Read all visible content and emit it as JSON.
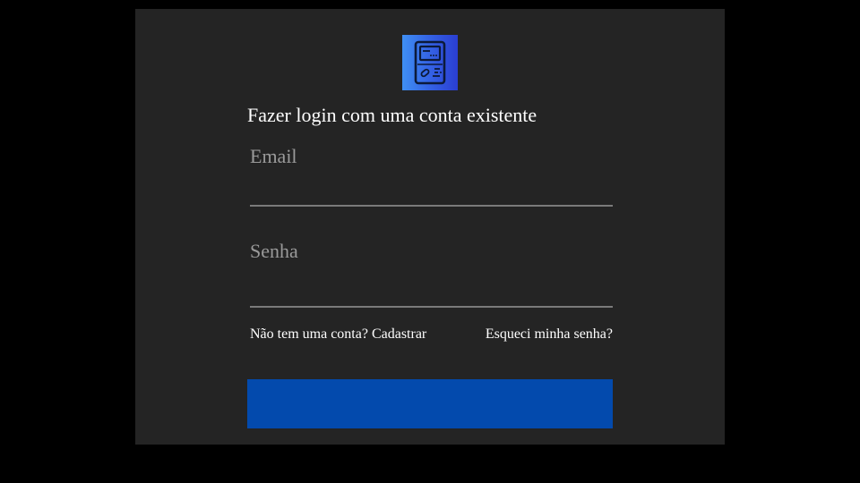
{
  "logo": {
    "icon": "handheld-game-console-icon",
    "gradient": [
      "#3f8ff3",
      "#2a3ed2"
    ]
  },
  "form": {
    "heading": "Fazer login com uma conta existente",
    "email": {
      "label": "Email",
      "value": ""
    },
    "password": {
      "label": "Senha",
      "value": ""
    },
    "signup_link": "Não tem uma conta? Cadastrar",
    "forgot_link": "Esqueci minha senha?",
    "submit_label": ""
  },
  "colors": {
    "page_background": "#000000",
    "panel_background": "#242424",
    "primary_button": "#034aad",
    "label": "#9a9a9a",
    "underline": "#7a7a7a"
  }
}
